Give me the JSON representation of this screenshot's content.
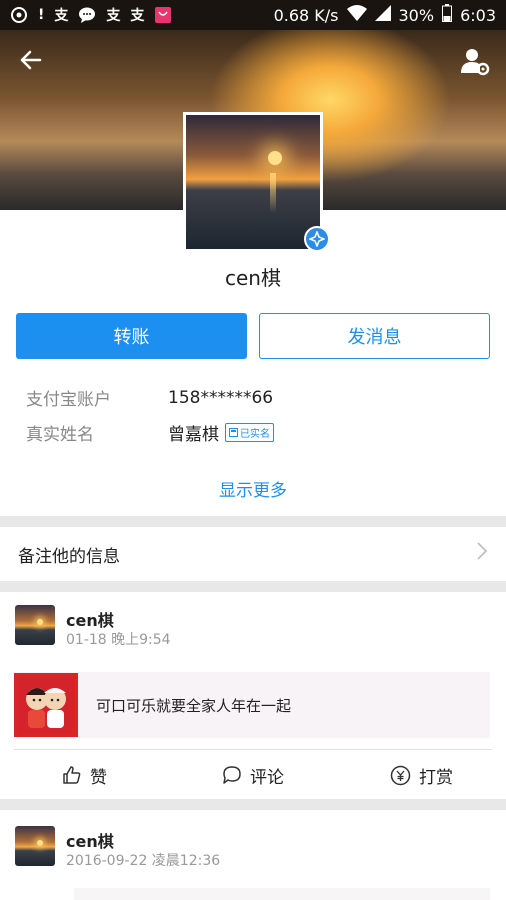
{
  "status_bar": {
    "network_speed": "0.68 K/s",
    "battery": "30%",
    "time": "6:03",
    "left_icons": [
      "weibo-icon",
      "alert-icon",
      "alipay-icon",
      "chat-icon",
      "alipay-icon",
      "alipay-icon",
      "shopping-icon"
    ]
  },
  "profile": {
    "username": "cen棋",
    "transfer_label": "转账",
    "message_label": "发消息",
    "account_label": "支付宝账户",
    "account_value": "158******66",
    "realname_label": "真实姓名",
    "realname_value": "曾嘉棋",
    "verified_badge": "已实名",
    "show_more": "显示更多"
  },
  "remark": {
    "label": "备注他的信息"
  },
  "feed": [
    {
      "name": "cen棋",
      "time": "01-18 晚上9:54",
      "share_text": "可口可乐就要全家人年在一起",
      "like_label": "赞",
      "comment_label": "评论",
      "reward_label": "打赏"
    },
    {
      "name": "cen棋",
      "time": "2016-09-22 凌晨12:36"
    }
  ],
  "colors": {
    "accent": "#1c8ff0",
    "divider": "#e8e8e8"
  }
}
